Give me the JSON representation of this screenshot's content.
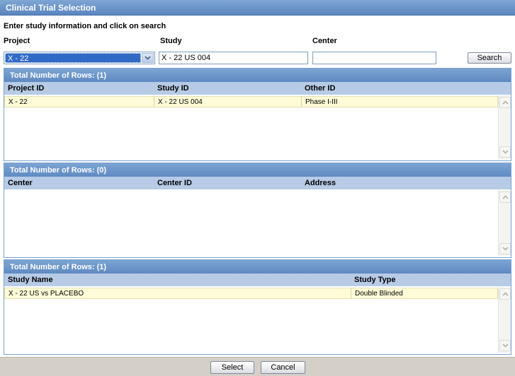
{
  "window": {
    "title": "Clinical Trial Selection"
  },
  "instruction": "Enter study information and click on search",
  "form": {
    "project_label": "Project",
    "study_label": "Study",
    "center_label": "Center",
    "project_value": "X - 22",
    "study_value": "X - 22 US 004",
    "center_value": "",
    "search_label": "Search"
  },
  "studies_section": {
    "title": "Total Number of Rows: (1)",
    "columns": [
      "Project ID",
      "Study ID",
      "Other ID"
    ],
    "rows": [
      {
        "project_id": "X - 22",
        "study_id": "X - 22 US 004",
        "other_id": "Phase I-III"
      }
    ]
  },
  "centers_section": {
    "title": "Total Number of Rows: (0)",
    "columns": [
      "Center",
      "Center ID",
      "Address"
    ],
    "rows": []
  },
  "study_type_section": {
    "title": "Total Number of Rows: (1)",
    "columns": [
      "Study Name",
      "Study Type"
    ],
    "rows": [
      {
        "study_name": "X - 22 US vs PLACEBO",
        "study_type": "Double Blinded"
      }
    ]
  },
  "footer": {
    "select_label": "Select",
    "cancel_label": "Cancel"
  },
  "icons": {
    "dropdown": "chevron-down-icon",
    "scroll_up": "scroll-up-arrow-icon",
    "scroll_down": "scroll-down-arrow-icon"
  },
  "colors": {
    "title_bar": "#6a94c9",
    "column_header": "#b7cbe6",
    "selected_row": "#fdfbd8",
    "selection_highlight": "#316ac5"
  }
}
